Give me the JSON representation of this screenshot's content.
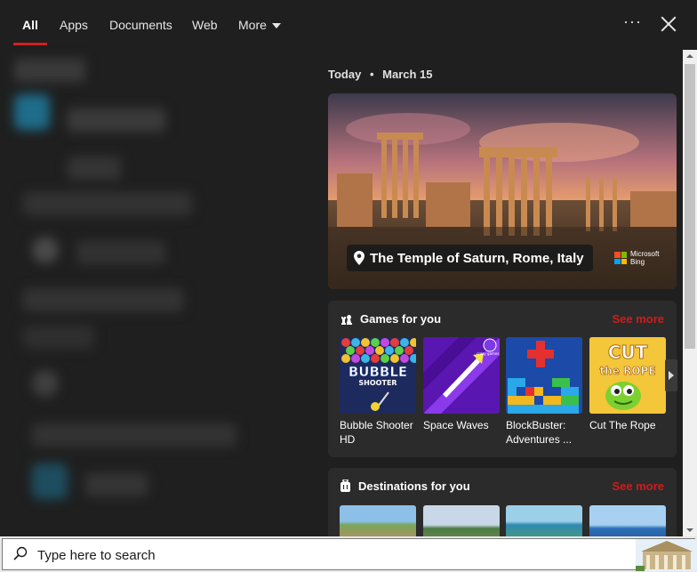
{
  "tabs": {
    "all": "All",
    "apps": "Apps",
    "documents": "Documents",
    "web": "Web",
    "more": "More"
  },
  "header": {
    "options_glyph": "···"
  },
  "right": {
    "date_label": "Today",
    "date_sep": "•",
    "date": "March 15",
    "hero": {
      "caption": "The Temple of Saturn, Rome, Italy",
      "brand_line1": "Microsoft",
      "brand_line2": "Bing"
    },
    "games": {
      "title": "Games for you",
      "see_more": "See more",
      "items": [
        {
          "name": "Bubble Shooter HD",
          "art_text": "BUBBLE",
          "art_sub": "SHOOTER"
        },
        {
          "name": "Space Waves",
          "art_badge": "crazy games"
        },
        {
          "name": "BlockBuster: Adventures ..."
        },
        {
          "name": "Cut The Rope",
          "art_text": "CUT",
          "art_sub": "the ROPE"
        }
      ]
    },
    "destinations": {
      "title": "Destinations for you",
      "see_more": "See more"
    }
  },
  "taskbar": {
    "search_placeholder": "Type here to search"
  },
  "colors": {
    "accent": "#d21f1f",
    "panel_bg": "#1f1f1f",
    "card_bg": "#2b2b2b"
  }
}
